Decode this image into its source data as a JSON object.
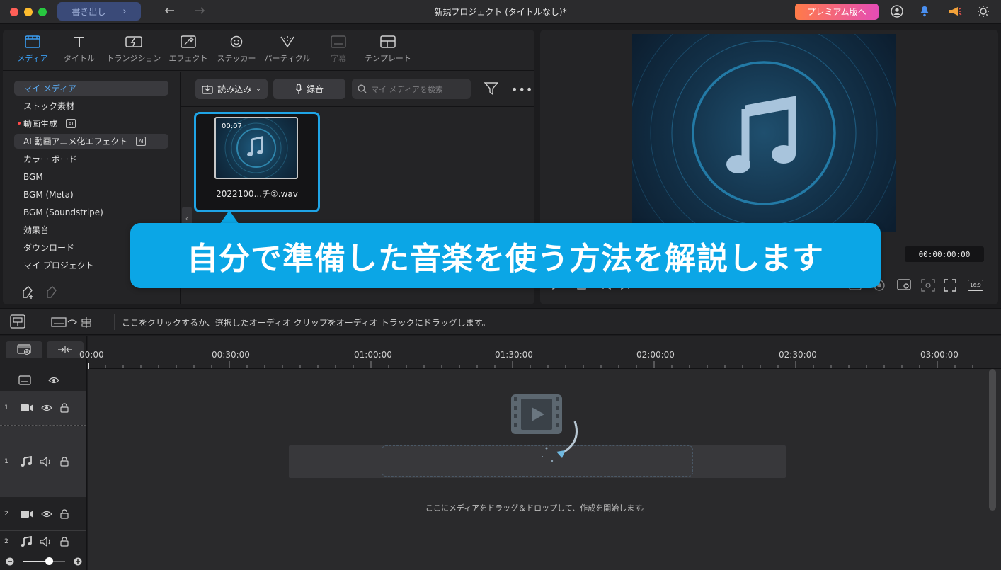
{
  "window": {
    "export_label": "書き出し",
    "title": "新規プロジェクト (タイトルなし)*",
    "premium_label": "プレミアム版へ"
  },
  "tabs": [
    {
      "label": "メディア",
      "icon": "media-icon",
      "state": "active"
    },
    {
      "label": "タイトル",
      "icon": "title-icon",
      "state": "normal"
    },
    {
      "label": "トランジション",
      "icon": "transition-icon",
      "state": "normal"
    },
    {
      "label": "エフェクト",
      "icon": "effect-icon",
      "state": "normal"
    },
    {
      "label": "ステッカー",
      "icon": "sticker-icon",
      "state": "normal"
    },
    {
      "label": "パーティクル",
      "icon": "particle-icon",
      "state": "normal"
    },
    {
      "label": "字幕",
      "icon": "subtitle-icon",
      "state": "disabled"
    },
    {
      "label": "テンプレート",
      "icon": "template-icon",
      "state": "normal"
    }
  ],
  "sidebar": {
    "items": [
      {
        "label": "マイ メディア"
      },
      {
        "label": "ストック素材"
      },
      {
        "label": "動画生成"
      },
      {
        "label": "AI 動画アニメ化エフェクト"
      },
      {
        "label": "カラー ボード"
      },
      {
        "label": "BGM"
      },
      {
        "label": "BGM (Meta)"
      },
      {
        "label": "BGM (Soundstripe)"
      },
      {
        "label": "効果音"
      },
      {
        "label": "ダウンロード"
      },
      {
        "label": "マイ プロジェクト"
      }
    ],
    "ai_badge": "AI"
  },
  "toolbar": {
    "import_label": "読み込み",
    "record_label": "録音",
    "search_placeholder": "マイ メディアを検索"
  },
  "clip": {
    "duration": "00:07",
    "filename": "2022100...チ②.wav"
  },
  "preview": {
    "timecode": "00:00:00:00",
    "aspect": "16:9"
  },
  "banner": {
    "text": "自分で準備した音楽を使う方法を解説します"
  },
  "timeline": {
    "hint": "ここをクリックするか、選択したオーディオ クリップをオーディオ トラックにドラッグします。",
    "ruler": [
      "00:00",
      "00:30:00",
      "01:00:00",
      "01:30:00",
      "02:00:00",
      "02:30:00",
      "03:00:00"
    ],
    "drop_text": "ここにメディアをドラッグ＆ドロップして、作成を開始します。",
    "tracks": [
      {
        "num": "1",
        "type": "video"
      },
      {
        "num": "1",
        "type": "audio"
      },
      {
        "num": "2",
        "type": "video"
      },
      {
        "num": "2",
        "type": "audio"
      }
    ]
  },
  "colors": {
    "accent": "#1fa4e6",
    "banner": "#0ba6e6",
    "premium_start": "#ff7b48",
    "premium_end": "#e54cb6",
    "active_tab": "#3a9cf0"
  }
}
